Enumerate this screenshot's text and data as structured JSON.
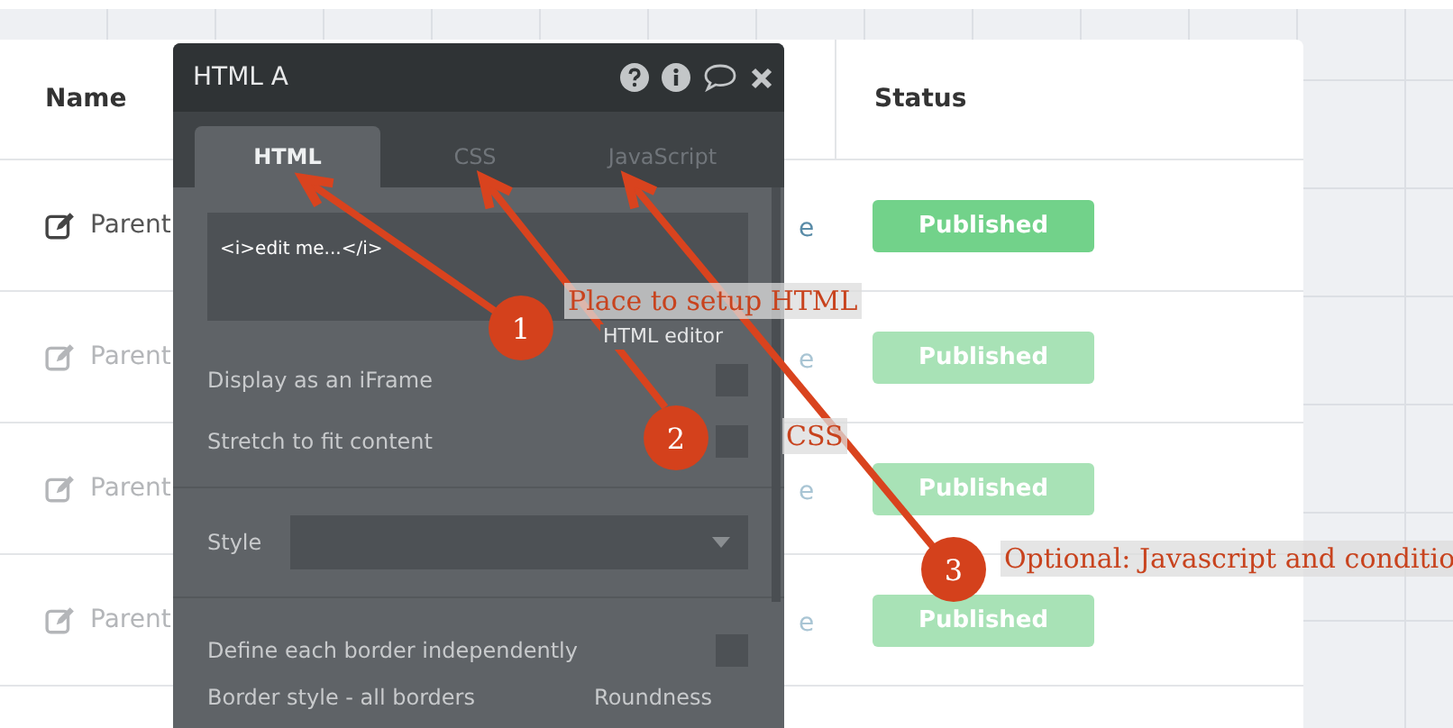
{
  "table": {
    "columns": [
      "Name",
      "Status"
    ],
    "rows": [
      {
        "name": "Parent",
        "column_2": "e",
        "status": "Published",
        "disabled": false
      },
      {
        "name": "Parent",
        "column_2": "e",
        "status": "Published",
        "disabled": true
      },
      {
        "name": "Parent",
        "column_2": "e",
        "status": "Published",
        "disabled": true
      },
      {
        "name": "Parent",
        "column_2": "e",
        "status": "Published",
        "disabled": true
      }
    ]
  },
  "panel": {
    "title": "HTML A",
    "tabs": [
      {
        "label": "HTML",
        "selected": true
      },
      {
        "label": "CSS",
        "selected": false
      },
      {
        "label": "JavaScript",
        "selected": false
      }
    ],
    "editor": {
      "value": "<i>edit me...</i>",
      "caption": "HTML editor"
    },
    "options": [
      {
        "kind": "checkbox",
        "label": "Display as an iFrame",
        "checked": false
      },
      {
        "kind": "checkbox",
        "label": "Stretch to fit content",
        "checked": false
      },
      {
        "kind": "dropdown",
        "label": "Style"
      },
      {
        "kind": "checkbox",
        "label": "Define each border independently",
        "checked": false
      }
    ],
    "footer_labels": [
      "Border style - all borders",
      "Roundness"
    ]
  },
  "annotations": [
    {
      "number": "1",
      "text": "Place to setup HTML"
    },
    {
      "number": "2",
      "text": "CSS"
    },
    {
      "number": "3",
      "text": "Optional: Javascript and conditio"
    }
  ]
}
